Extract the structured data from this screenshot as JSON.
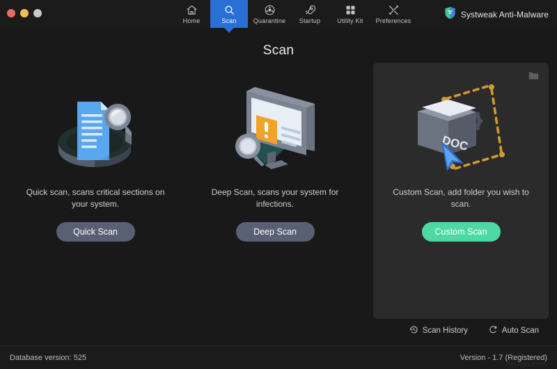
{
  "window": {
    "controls": [
      {
        "name": "close",
        "color": "#ed6a5e"
      },
      {
        "name": "minimize",
        "color": "#f4bf50"
      },
      {
        "name": "zoom",
        "color": "#c9c9c9"
      }
    ]
  },
  "header": {
    "nav": [
      {
        "label": "Home",
        "icon": "home-icon",
        "active": false
      },
      {
        "label": "Scan",
        "icon": "search-icon",
        "active": true
      },
      {
        "label": "Quarantine",
        "icon": "radiation-icon",
        "active": false
      },
      {
        "label": "Startup",
        "icon": "rocket-icon",
        "active": false
      },
      {
        "label": "Utility Kit",
        "icon": "grid-icon",
        "active": false
      },
      {
        "label": "Preferences",
        "icon": "tools-icon",
        "active": false
      }
    ],
    "brand": {
      "name": "Systweak Anti-Malware",
      "icon": "shield-icon",
      "color_primary": "#45c98a",
      "color_secondary": "#3f87d8"
    },
    "active_color": "#2a6fd6"
  },
  "page": {
    "title": "Scan"
  },
  "cards": [
    {
      "id": "quick-scan",
      "art": "document-magnifier-illustration",
      "description": "Quick scan, scans critical sections on your system.",
      "button_label": "Quick Scan",
      "button_color": "#5a6073",
      "highlighted": false
    },
    {
      "id": "deep-scan",
      "art": "monitor-warning-illustration",
      "description": "Deep Scan, scans your system for infections.",
      "button_label": "Deep Scan",
      "button_color": "#5a6073",
      "highlighted": false
    },
    {
      "id": "custom-scan",
      "art": "folder-cursor-illustration",
      "description": "Custom Scan, add folder you wish to scan.",
      "button_label": "Custom Scan",
      "button_color": "#4ed9a4",
      "highlighted": true,
      "corner_icon": "folder-icon"
    }
  ],
  "actions": [
    {
      "label": "Scan History",
      "icon": "clock-icon"
    },
    {
      "label": "Auto Scan",
      "icon": "auto-refresh-icon"
    }
  ],
  "footer": {
    "database_version": "Database version: 525",
    "version": "Version  -  1.7 (Registered)",
    "watermark": "wsxdn.com"
  }
}
